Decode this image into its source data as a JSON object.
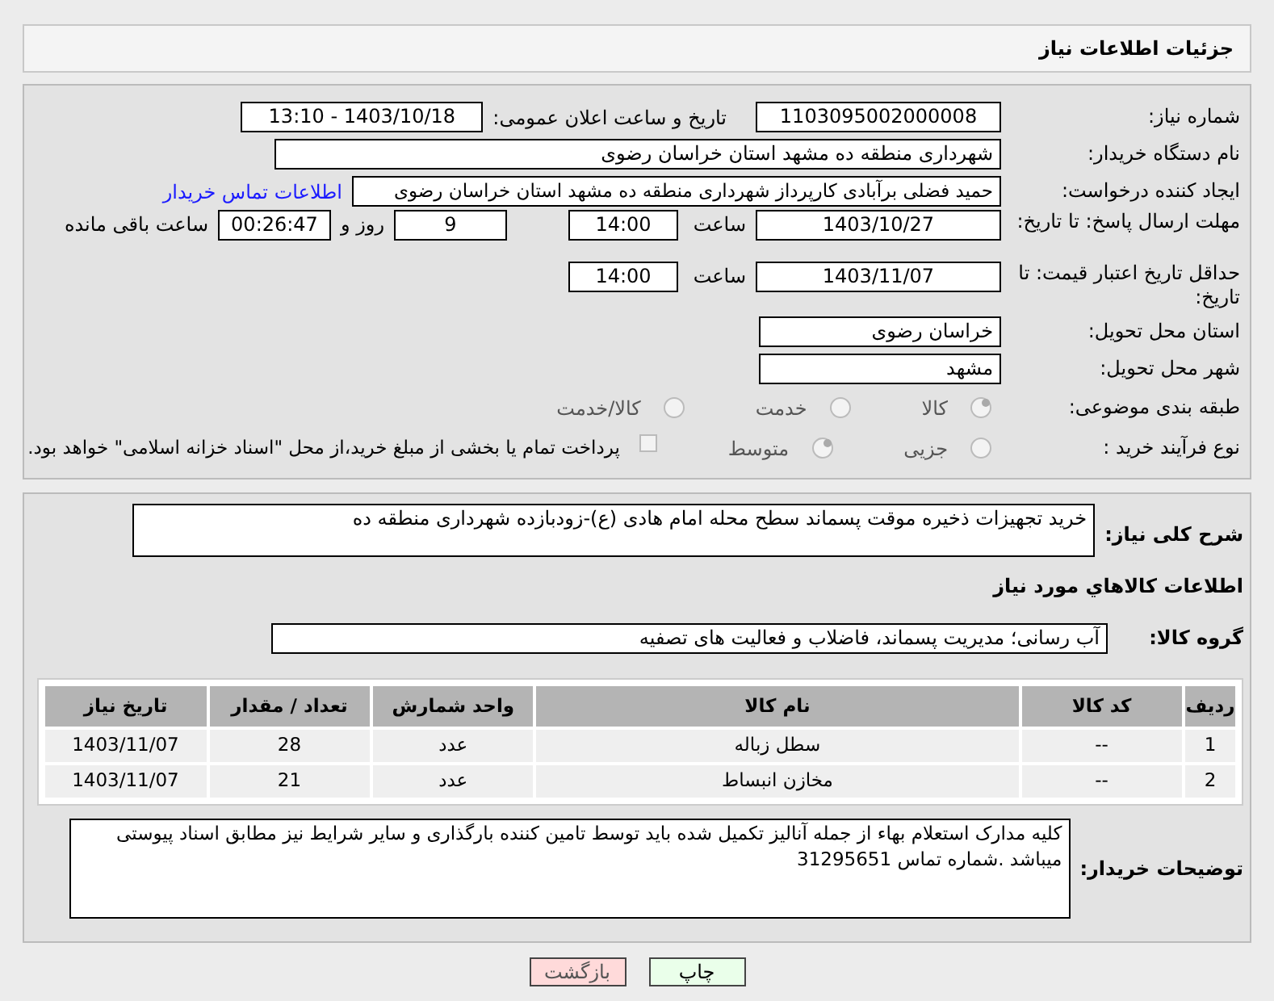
{
  "header": {
    "title": "جزئیات اطلاعات نیاز"
  },
  "fields": {
    "need_number": {
      "label": "شماره نیاز:",
      "value": "1103095002000008"
    },
    "announce": {
      "label": "تاریخ و ساعت اعلان عمومی:",
      "value": "1403/10/18 - 13:10"
    },
    "buyer": {
      "label": "نام دستگاه خریدار:",
      "value": "شهرداری منطقه ده مشهد استان خراسان رضوی"
    },
    "creator": {
      "label": "ایجاد کننده درخواست:",
      "value": "حمید فضلی برآبادی کارپرداز شهرداری منطقه ده مشهد استان خراسان رضوی",
      "link": "اطلاعات تماس خریدار"
    },
    "deadline": {
      "label": "مهلت ارسال پاسخ: تا تاریخ:",
      "date": "1403/10/27",
      "time_label": "ساعت",
      "time": "14:00",
      "days": "9",
      "days_label": "روز و",
      "remaining": "00:26:47",
      "remaining_label": "ساعت باقی مانده"
    },
    "validity": {
      "label": "حداقل تاریخ اعتبار قیمت: تا تاریخ:",
      "date": "1403/11/07",
      "time_label": "ساعت",
      "time": "14:00"
    },
    "province": {
      "label": "استان محل تحویل:",
      "value": "خراسان رضوی"
    },
    "city": {
      "label": "شهر محل تحویل:",
      "value": "مشهد"
    },
    "category": {
      "label": "طبقه بندی موضوعی:",
      "options": [
        {
          "label": "كالا",
          "selected": true
        },
        {
          "label": "خدمت",
          "selected": false
        },
        {
          "label": "كالا/خدمت",
          "selected": false
        }
      ]
    },
    "process": {
      "label": "نوع فرآیند خرید :",
      "options": [
        {
          "label": "جزیی",
          "selected": false
        },
        {
          "label": "متوسط",
          "selected": true
        }
      ],
      "payment": {
        "checked": false,
        "text": "پرداخت تمام یا بخشی از مبلغ خرید،از محل \"اسناد خزانه اسلامی\" خواهد بود."
      }
    }
  },
  "summary": {
    "label": "شرح کلی نیاز:",
    "value": "خرید تجهیزات ذخیره موقت پسماند سطح محله امام هادی (ع)-زودبازده شهرداری منطقه ده"
  },
  "goods_heading": "اطلاعات كالاهاي مورد نیاز",
  "goods_group": {
    "label": "گروه کالا:",
    "value": "آب رسانی؛ مدیریت پسماند، فاضلاب و فعالیت های تصفیه"
  },
  "table": {
    "columns": [
      "ردیف",
      "کد کالا",
      "نام کالا",
      "واحد شمارش",
      "تعداد / مقدار",
      "تاریخ نیاز"
    ],
    "rows": [
      [
        "1",
        "--",
        "سطل زباله",
        "عدد",
        "28",
        "1403/11/07"
      ],
      [
        "2",
        "--",
        "مخازن انبساط",
        "عدد",
        "21",
        "1403/11/07"
      ]
    ]
  },
  "buyer_notes": {
    "label": "توضیحات خریدار:",
    "value": "کلیه مدارک  استعلام بهاء  از جمله آنالیز تکمیل شده باید توسط تامین کننده بارگذاری  و سایر شرایط  نیز مطابق اسناد پیوستی میباشد .شماره تماس  31295651"
  },
  "buttons": [
    {
      "kind": "print",
      "label": "چاپ"
    },
    {
      "kind": "back",
      "label": "بازگشت"
    }
  ]
}
